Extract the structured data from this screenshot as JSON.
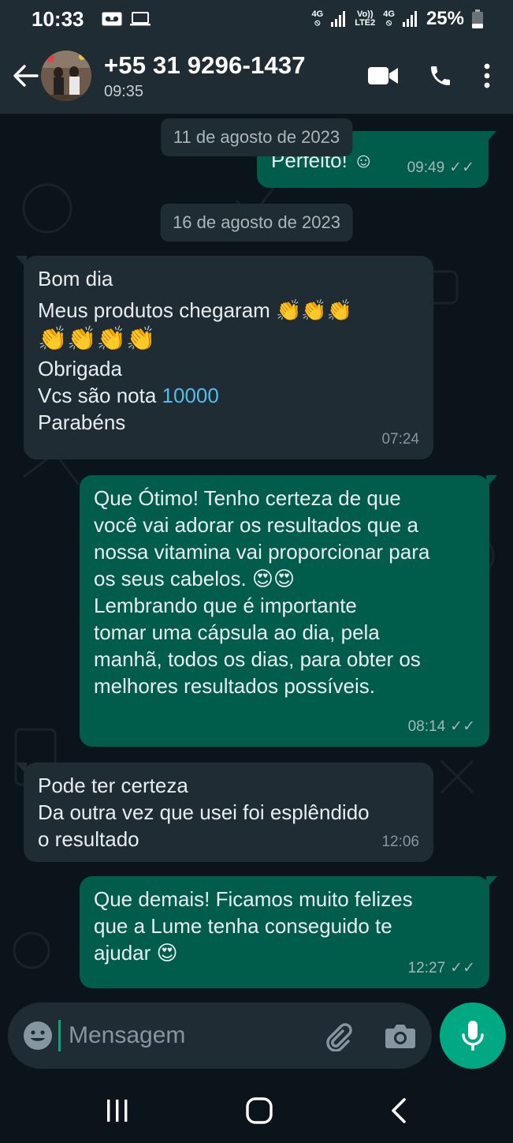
{
  "status_bar": {
    "time": "10:33",
    "net1": "4G",
    "net2_top": "Vo))",
    "net2_bottom": "LTE2",
    "net3": "4G",
    "battery": "25%"
  },
  "header": {
    "contact_name": "+55 31 9296-1437",
    "last_seen": "09:35",
    "icons": [
      "back-arrow-icon",
      "video-call-icon",
      "phone-icon",
      "more-vert-icon"
    ]
  },
  "messages": [
    {
      "type": "out",
      "lines": [
        "Perfeito! ☺"
      ],
      "time": "09:49",
      "ticks": "✓✓"
    },
    {
      "type": "date",
      "label": "11 de agosto de 2023"
    },
    {
      "type": "date",
      "label": "16 de agosto de 2023"
    },
    {
      "type": "in",
      "lines": [
        "Bom dia",
        "Meus produtos chegaram 👏👏👏",
        "👏👏👏👏",
        "Obrigada",
        "Vcs são nota ",
        "Parabéns"
      ],
      "link": "10000",
      "time": "07:24"
    },
    {
      "type": "out",
      "lines": [
        "Que Ótimo! Tenho certeza de que",
        "você vai adorar os resultados que a",
        "nossa vitamina vai proporcionar para",
        "os seus cabelos. 😍😍",
        "Lembrando que é importante",
        "tomar uma cápsula ao dia, pela",
        "manhã, todos os dias, para obter os",
        "melhores resultados possíveis."
      ],
      "time": "08:14",
      "ticks": "✓✓"
    },
    {
      "type": "in",
      "lines": [
        "Pode ter certeza",
        "Da outra vez que usei foi esplêndido",
        "o resultado"
      ],
      "time": "12:06"
    },
    {
      "type": "out",
      "lines": [
        "Que demais! Ficamos muito felizes",
        "que a Lume tenha conseguido te",
        "ajudar  😍"
      ],
      "time": "12:27",
      "ticks": "✓✓"
    }
  ],
  "composer": {
    "placeholder": "Mensagem"
  },
  "colors": {
    "background": "#0b141a",
    "incoming": "#1f2c34",
    "outgoing": "#005c4b",
    "accent": "#00a884",
    "link": "#53bdeb"
  }
}
